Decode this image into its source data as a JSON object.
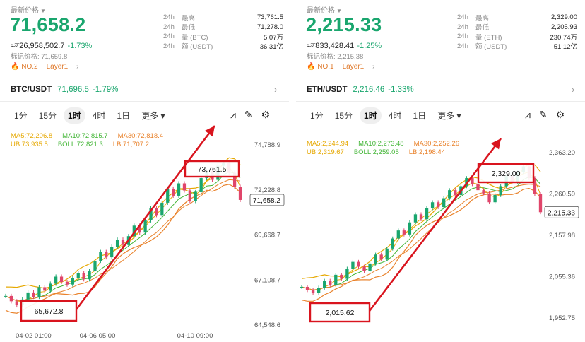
{
  "panels": [
    {
      "latest_price_label": "最新价格",
      "price": "71,658.2",
      "approx_value": "≈ৰ26,958,502.7",
      "change_pct": "-1.73%",
      "mark_price": "标记价格: 71,659.8",
      "rank_tag": "NO.2",
      "layer_tag": "Layer1",
      "stats": [
        {
          "period": "24h",
          "label": "最高",
          "value": "73,761.5"
        },
        {
          "period": "24h",
          "label": "最低",
          "value": "71,278.0"
        },
        {
          "period": "24h",
          "label": "量 (BTC)",
          "value": "5.07万"
        },
        {
          "period": "24h",
          "label": "额 (USDT)",
          "value": "36.31亿"
        }
      ],
      "pair": "BTC/USDT",
      "pair_price": "71,696.5",
      "pair_change": "-1.79%",
      "timeframes": [
        "1分",
        "15分",
        "1时",
        "4时",
        "1日",
        "更多"
      ],
      "active_timeframe": "1时",
      "indicators": {
        "ma5": "MA5:72,206.8",
        "ma10": "MA10:72,815.7",
        "ma30": "MA30:72,818.4",
        "ub": "UB:73,935.5",
        "boll": "BOLL:72,821.3",
        "lb": "LB:71,707.2"
      },
      "y_ticks": [
        "74,788.9",
        "72,228.8",
        "69,668.7",
        "67,108.7",
        "64,548.6"
      ],
      "x_ticks": [
        "04-02 01:00",
        "04-06 05:00",
        "04-10 09:00"
      ],
      "annotation_high": "73,761.5",
      "annotation_low": "65,672.8",
      "current_price_tag": "71,658.2",
      "series": {
        "y_range": [
          64548.6,
          74788.9
        ],
        "closes": [
          66200,
          65900,
          65672.8,
          66000,
          66400,
          66150,
          66700,
          66500,
          66900,
          67300,
          67000,
          66850,
          67200,
          67500,
          67150,
          67600,
          68200,
          68700,
          68400,
          69000,
          69400,
          69100,
          69600,
          70200,
          69800,
          70500,
          71200,
          70800,
          71500,
          72300,
          71900,
          72600,
          72200,
          71600,
          72100,
          72900,
          73300,
          72800,
          73600,
          73761.5,
          73200,
          72400,
          71658.2
        ]
      }
    },
    {
      "latest_price_label": "最新价格",
      "price": "2,215.33",
      "approx_value": "≈ৰ833,428.41",
      "change_pct": "-1.25%",
      "mark_price": "标记价格: 2,215.38",
      "rank_tag": "NO.1",
      "layer_tag": "Layer1",
      "stats": [
        {
          "period": "24h",
          "label": "最高",
          "value": "2,329.00"
        },
        {
          "period": "24h",
          "label": "最低",
          "value": "2,205.93"
        },
        {
          "period": "24h",
          "label": "量 (ETH)",
          "value": "230.74万"
        },
        {
          "period": "24h",
          "label": "额 (USDT)",
          "value": "51.12亿"
        }
      ],
      "pair": "ETH/USDT",
      "pair_price": "2,216.46",
      "pair_change": "-1.33%",
      "timeframes": [
        "1分",
        "15分",
        "1时",
        "4时",
        "1日",
        "更多"
      ],
      "active_timeframe": "1时",
      "indicators": {
        "ma5": "MA5:2,244.94",
        "ma10": "MA10:2,273.48",
        "ma30": "MA30:2,252.26",
        "ub": "UB:2,319.67",
        "boll": "BOLL:2,259.05",
        "lb": "LB:2,198.44"
      },
      "y_ticks": [
        "2,363.20",
        "2,260.59",
        "2,157.98",
        "2,055.36",
        "1,952.75"
      ],
      "x_ticks": [],
      "annotation_high": "2,329.00",
      "annotation_low": "2,015.62",
      "current_price_tag": "2,215.33",
      "series": {
        "y_range": [
          1952.75,
          2363.2
        ],
        "closes": [
          2030,
          2022,
          2015.62,
          2028,
          2045,
          2035,
          2060,
          2050,
          2075,
          2092,
          2080,
          2070,
          2088,
          2110,
          2098,
          2125,
          2150,
          2170,
          2160,
          2190,
          2210,
          2198,
          2225,
          2240,
          2228,
          2250,
          2270,
          2258,
          2280,
          2300,
          2285,
          2270,
          2262,
          2240,
          2258,
          2280,
          2305,
          2290,
          2315,
          2329.0,
          2300,
          2260,
          2215.33
        ]
      }
    }
  ]
}
